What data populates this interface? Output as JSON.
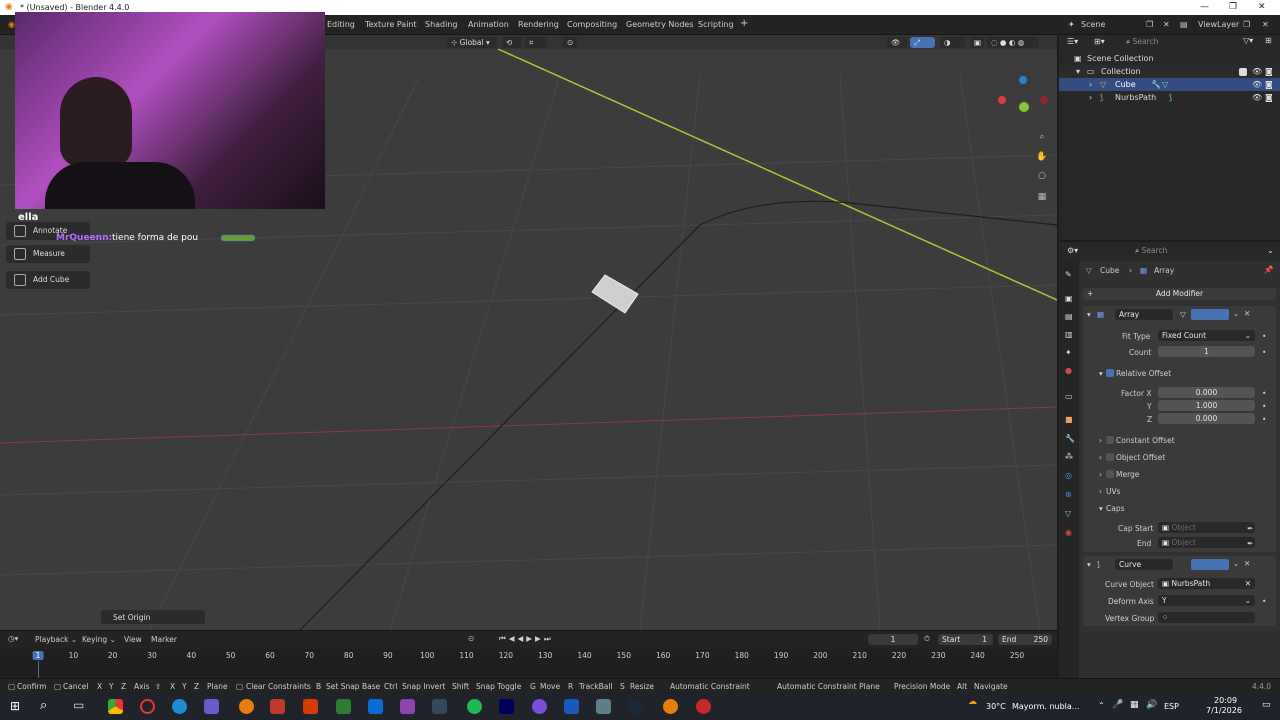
{
  "window": {
    "title": "* (Unsaved) - Blender 4.4.0"
  },
  "topbar": {
    "workspaces": [
      "Editing",
      "Texture Paint",
      "Shading",
      "Animation",
      "Rendering",
      "Compositing",
      "Geometry Nodes",
      "Scripting"
    ],
    "add": "+",
    "scene": "Scene",
    "viewlayer": "ViewLayer"
  },
  "viewport": {
    "transform_orientation": "Global",
    "tools": [
      "Annotate",
      "Measure",
      "Add Cube"
    ],
    "operator_panel": "Set Origin",
    "overlay_text": {
      "label": "ella",
      "user": "MrQueenn:",
      "message": "tiene forma de pou"
    }
  },
  "outliner": {
    "search_placeholder": "Search",
    "items": [
      "Scene Collection",
      "Collection",
      "Cube",
      "NurbsPath"
    ]
  },
  "properties": {
    "search_placeholder": "Search",
    "breadcrumb": {
      "object": "Cube",
      "modifier": "Array"
    },
    "add_modifier": "Add Modifier",
    "array": {
      "name": "Array",
      "fit_type_label": "Fit Type",
      "fit_type": "Fixed Count",
      "count_label": "Count",
      "count": "1",
      "relative_offset": "Relative Offset",
      "factor_x_label": "Factor X",
      "factor_x": "0.000",
      "y_label": "Y",
      "factor_y": "1.000",
      "z_label": "Z",
      "factor_z": "0.000",
      "constant_offset": "Constant Offset",
      "object_offset": "Object Offset",
      "merge": "Merge",
      "uvs": "UVs",
      "caps": "Caps",
      "cap_start_label": "Cap Start",
      "cap_end_label": "End",
      "cap_placeholder": "Object"
    },
    "curve": {
      "name": "Curve",
      "curve_object_label": "Curve Object",
      "curve_object": "NurbsPath",
      "deform_axis_label": "Deform Axis",
      "deform_axis": "Y",
      "vertex_group_label": "Vertex Group"
    }
  },
  "timeline": {
    "menus": [
      "Playback",
      "Keying",
      "View",
      "Marker"
    ],
    "current_frame": "1",
    "start_label": "Start",
    "start": "1",
    "end_label": "End",
    "end": "250",
    "ticks": [
      "1",
      "10",
      "20",
      "30",
      "40",
      "50",
      "60",
      "70",
      "80",
      "90",
      "100",
      "110",
      "120",
      "130",
      "140",
      "150",
      "160",
      "170",
      "180",
      "190",
      "200",
      "210",
      "220",
      "230",
      "240",
      "250"
    ]
  },
  "statusbar": {
    "items": [
      "Confirm",
      "Cancel",
      "X",
      "Y",
      "Z",
      "Axis",
      "X",
      "Y",
      "Z",
      "Plane",
      "Clear Constraints",
      "Set Snap Base",
      "Snap Invert",
      "Snap Toggle",
      "Move",
      "TrackBall",
      "Resize",
      "Automatic Constraint",
      "Automatic Constraint Plane",
      "Precision Mode",
      "Navigate"
    ],
    "keys": [
      "Ctrl",
      "Shift",
      "G",
      "R",
      "S",
      "Alt"
    ],
    "version": "4.4.0"
  },
  "taskbar": {
    "weather": "30°C",
    "weather_text": "Mayorm. nubla...",
    "language": "ESP",
    "time": "20:09",
    "date": "7/1/2026"
  }
}
